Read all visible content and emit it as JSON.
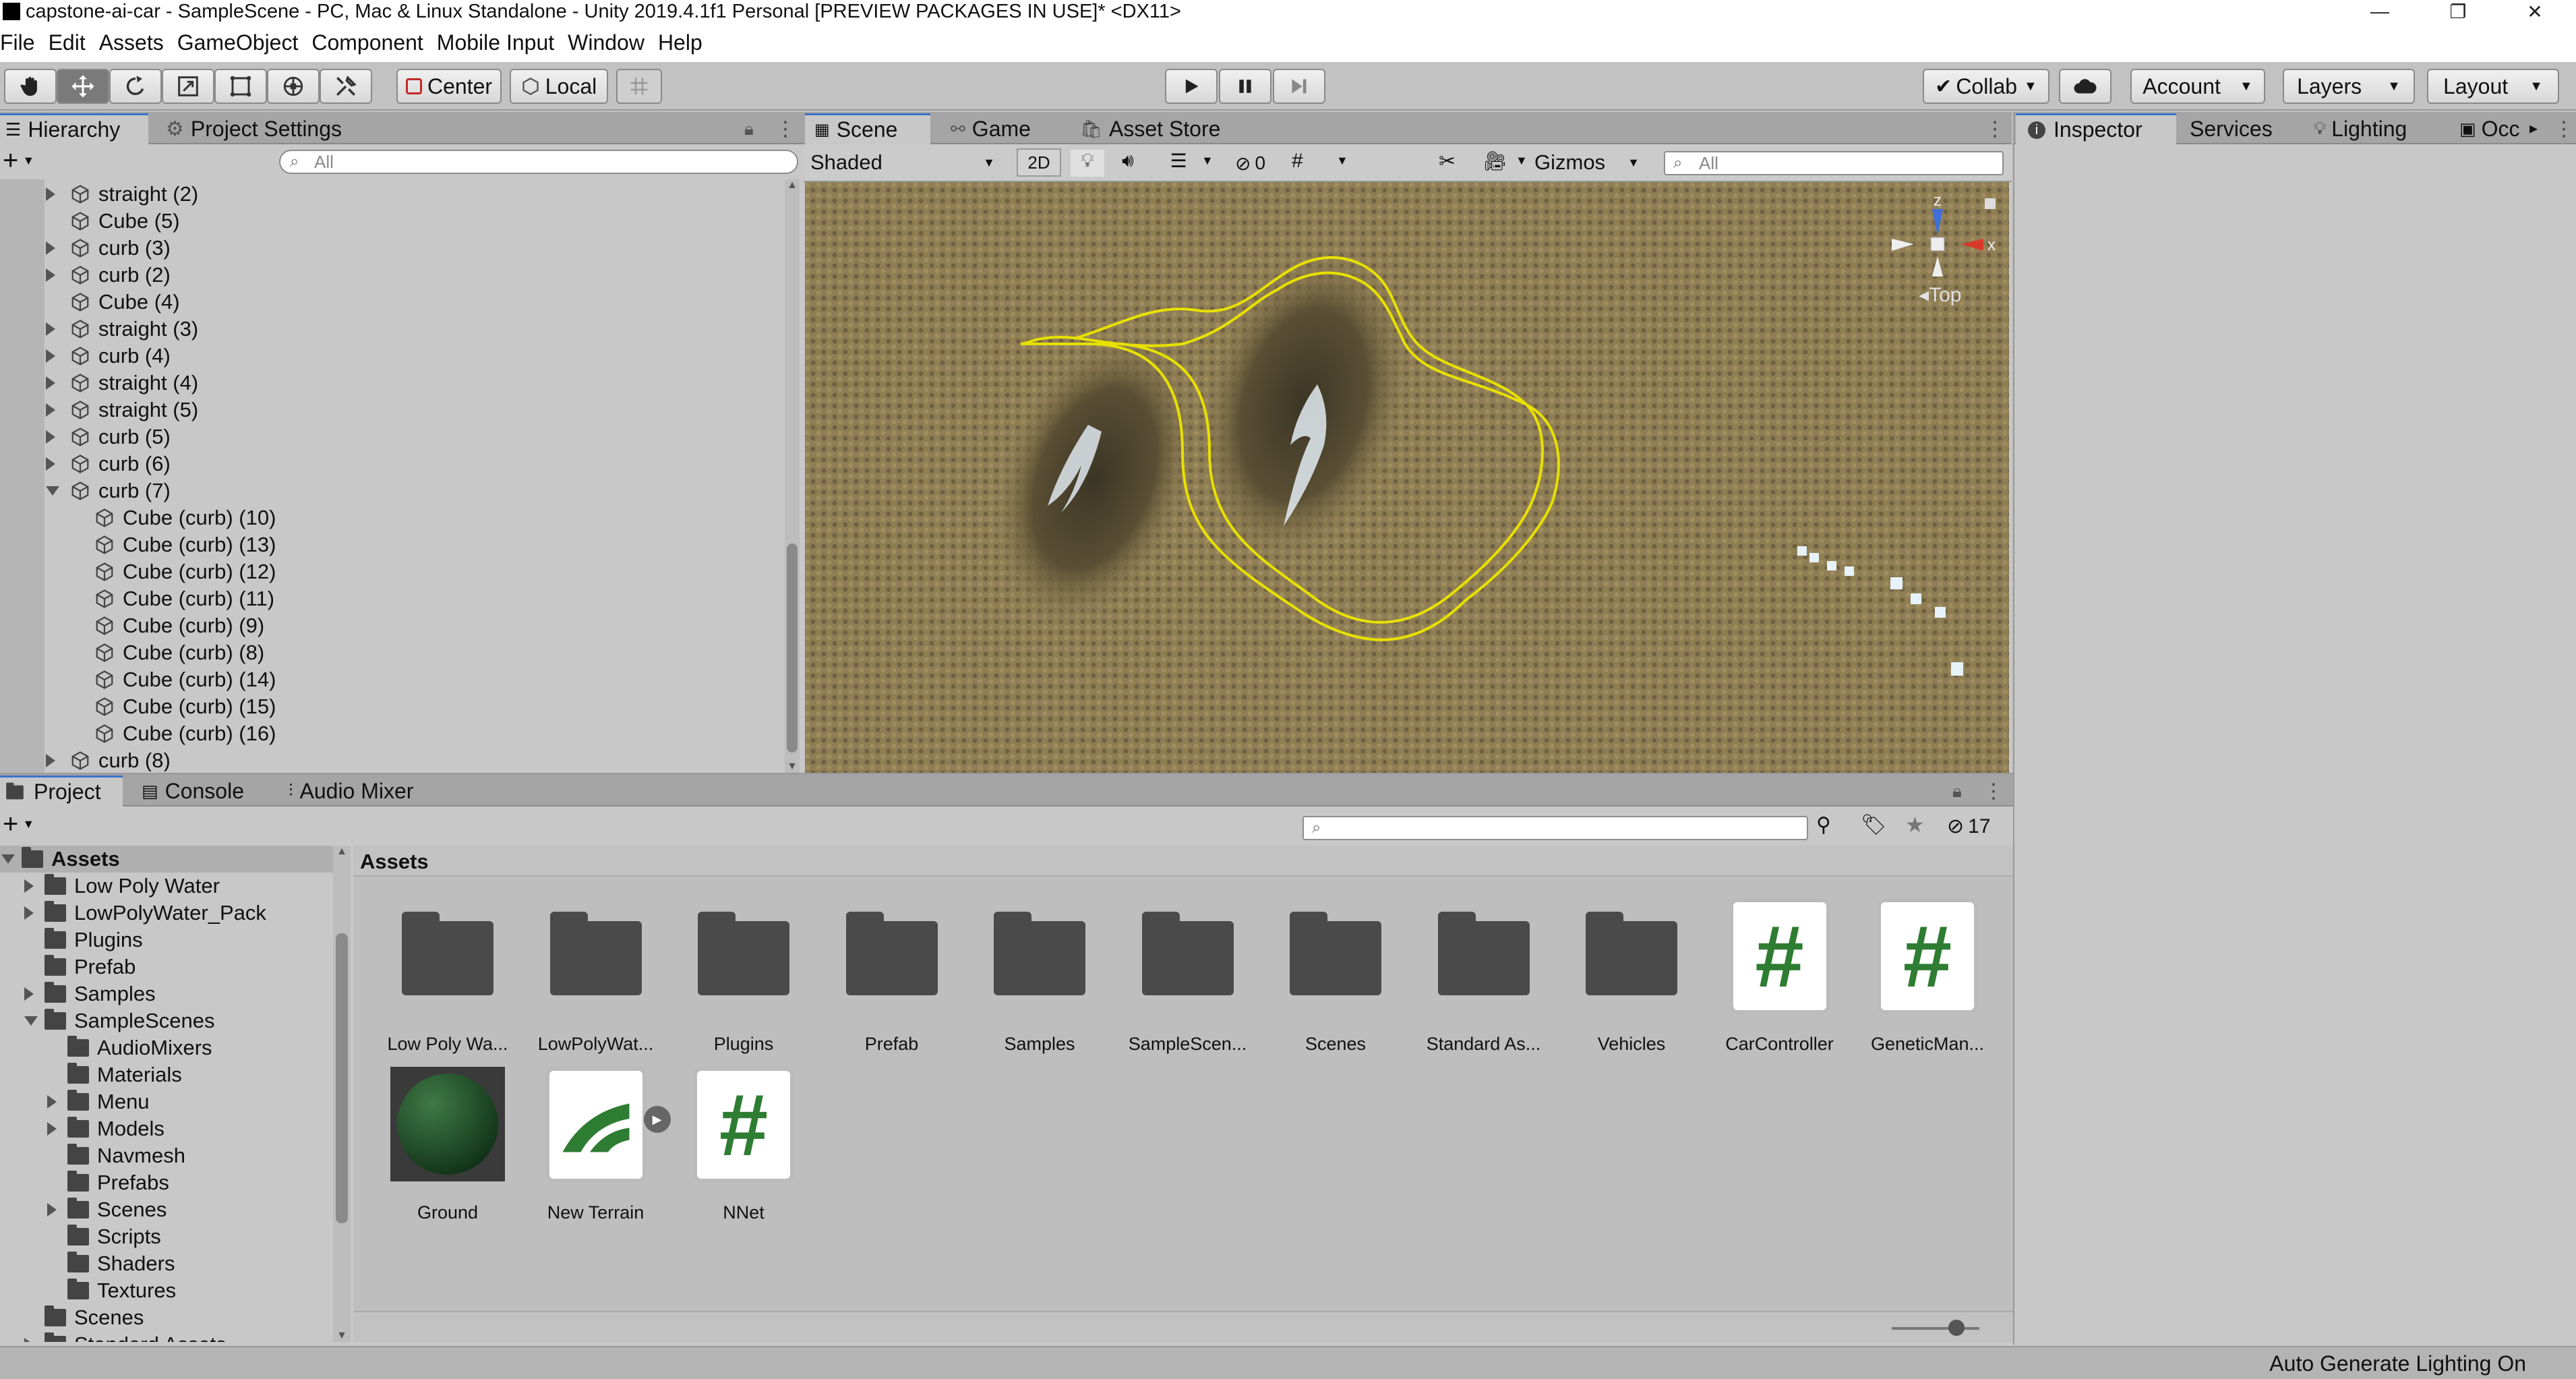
{
  "window": {
    "title": "capstone-ai-car - SampleScene - PC, Mac & Linux Standalone - Unity 2019.4.1f1 Personal [PREVIEW PACKAGES IN USE]* <DX11>",
    "minimize": "—",
    "restore": "❐",
    "close": "✕"
  },
  "menu": [
    "File",
    "Edit",
    "Assets",
    "GameObject",
    "Component",
    "Mobile Input",
    "Window",
    "Help"
  ],
  "toolbar": {
    "center": "Center",
    "local": "Local",
    "collab": "Collab",
    "account": "Account",
    "layers": "Layers",
    "layout": "Layout"
  },
  "hierarchy": {
    "tab": "Hierarchy",
    "tab2": "Project Settings",
    "add": "+",
    "search_placeholder": "All",
    "items": [
      {
        "label": "straight (2)",
        "indent": 1,
        "arrow": "right"
      },
      {
        "label": "Cube (5)",
        "indent": 1,
        "arrow": "none"
      },
      {
        "label": "curb (3)",
        "indent": 1,
        "arrow": "right"
      },
      {
        "label": "curb (2)",
        "indent": 1,
        "arrow": "right"
      },
      {
        "label": "Cube (4)",
        "indent": 1,
        "arrow": "none"
      },
      {
        "label": "straight (3)",
        "indent": 1,
        "arrow": "right"
      },
      {
        "label": "curb (4)",
        "indent": 1,
        "arrow": "right"
      },
      {
        "label": "straight (4)",
        "indent": 1,
        "arrow": "right"
      },
      {
        "label": "straight (5)",
        "indent": 1,
        "arrow": "right"
      },
      {
        "label": "curb (5)",
        "indent": 1,
        "arrow": "right"
      },
      {
        "label": "curb (6)",
        "indent": 1,
        "arrow": "right"
      },
      {
        "label": "curb (7)",
        "indent": 1,
        "arrow": "down"
      },
      {
        "label": "Cube (curb) (10)",
        "indent": 2,
        "arrow": "none"
      },
      {
        "label": "Cube (curb) (13)",
        "indent": 2,
        "arrow": "none"
      },
      {
        "label": "Cube (curb) (12)",
        "indent": 2,
        "arrow": "none"
      },
      {
        "label": "Cube (curb) (11)",
        "indent": 2,
        "arrow": "none"
      },
      {
        "label": "Cube (curb) (9)",
        "indent": 2,
        "arrow": "none"
      },
      {
        "label": "Cube (curb) (8)",
        "indent": 2,
        "arrow": "none"
      },
      {
        "label": "Cube (curb) (14)",
        "indent": 2,
        "arrow": "none"
      },
      {
        "label": "Cube (curb) (15)",
        "indent": 2,
        "arrow": "none"
      },
      {
        "label": "Cube (curb) (16)",
        "indent": 2,
        "arrow": "none"
      },
      {
        "label": "curb (8)",
        "indent": 1,
        "arrow": "right"
      }
    ]
  },
  "scene": {
    "tabs": [
      "Scene",
      "Game",
      "Asset Store"
    ],
    "shading": "Shaded",
    "mode2d": "2D",
    "hidden_count": "0",
    "gizmos": "Gizmos",
    "search_placeholder": "All",
    "gizmo_label": "Top",
    "axis_z": "z",
    "axis_x": "x"
  },
  "inspector": {
    "tabs": [
      "Inspector",
      "Services",
      "Lighting",
      "Occ"
    ]
  },
  "project": {
    "tabs": [
      "Project",
      "Console",
      "Audio Mixer"
    ],
    "add": "+",
    "breadcrumb": "Assets",
    "hidden_count": "17",
    "tree": [
      {
        "label": "Assets",
        "indent": 0,
        "arrow": "down",
        "bold": true,
        "open": true
      },
      {
        "label": "Low Poly Water",
        "indent": 1,
        "arrow": "right"
      },
      {
        "label": "LowPolyWater_Pack",
        "indent": 1,
        "arrow": "right"
      },
      {
        "label": "Plugins",
        "indent": 1,
        "arrow": "none"
      },
      {
        "label": "Prefab",
        "indent": 1,
        "arrow": "none"
      },
      {
        "label": "Samples",
        "indent": 1,
        "arrow": "right"
      },
      {
        "label": "SampleScenes",
        "indent": 1,
        "arrow": "down",
        "open": true
      },
      {
        "label": "AudioMixers",
        "indent": 2,
        "arrow": "none"
      },
      {
        "label": "Materials",
        "indent": 2,
        "arrow": "none"
      },
      {
        "label": "Menu",
        "indent": 2,
        "arrow": "right"
      },
      {
        "label": "Models",
        "indent": 2,
        "arrow": "right"
      },
      {
        "label": "Navmesh",
        "indent": 2,
        "arrow": "none"
      },
      {
        "label": "Prefabs",
        "indent": 2,
        "arrow": "none"
      },
      {
        "label": "Scenes",
        "indent": 2,
        "arrow": "right"
      },
      {
        "label": "Scripts",
        "indent": 2,
        "arrow": "none"
      },
      {
        "label": "Shaders",
        "indent": 2,
        "arrow": "none"
      },
      {
        "label": "Textures",
        "indent": 2,
        "arrow": "none"
      },
      {
        "label": "Scenes",
        "indent": 1,
        "arrow": "none"
      },
      {
        "label": "Standard Assets",
        "indent": 1,
        "arrow": "right"
      }
    ],
    "assets": [
      {
        "label": "Low Poly Wa...",
        "kind": "folder"
      },
      {
        "label": "LowPolyWat...",
        "kind": "folder"
      },
      {
        "label": "Plugins",
        "kind": "folder"
      },
      {
        "label": "Prefab",
        "kind": "folder"
      },
      {
        "label": "Samples",
        "kind": "folder"
      },
      {
        "label": "SampleScen...",
        "kind": "folder"
      },
      {
        "label": "Scenes",
        "kind": "folder"
      },
      {
        "label": "Standard As...",
        "kind": "folder"
      },
      {
        "label": "Vehicles",
        "kind": "folder"
      },
      {
        "label": "CarController",
        "kind": "script"
      },
      {
        "label": "GeneticMan...",
        "kind": "script"
      },
      {
        "label": "Ground",
        "kind": "material"
      },
      {
        "label": "New Terrain",
        "kind": "terrain"
      },
      {
        "label": "NNet",
        "kind": "script"
      }
    ]
  },
  "status": {
    "text": "Auto Generate Lighting On"
  }
}
